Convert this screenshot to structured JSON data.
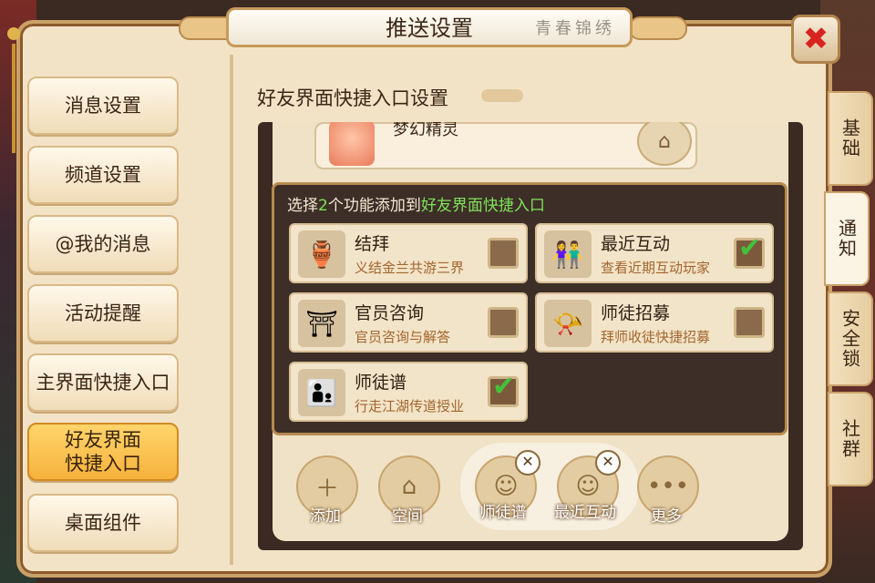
{
  "window": {
    "title": "推送设置",
    "title_deco": "青春锦绣",
    "close_glyph": "✖"
  },
  "nav": {
    "items": [
      {
        "label": "消息设置"
      },
      {
        "label": "频道设置"
      },
      {
        "label": "@我的消息"
      },
      {
        "label": "活动提醒"
      },
      {
        "label": "主界面快捷入口"
      },
      {
        "label": "好友界面快捷入口",
        "active": true
      },
      {
        "label": "桌面组件"
      }
    ]
  },
  "side_tabs": [
    {
      "label": "基础"
    },
    {
      "label": "通知",
      "active": true
    },
    {
      "label": "安全锁"
    },
    {
      "label": "社群"
    }
  ],
  "section": {
    "title": "好友界面快捷入口设置"
  },
  "preview": {
    "friend_name": "梦幻精灵",
    "home_icon": "home-icon",
    "bottom": {
      "add_label": "添加",
      "space_label": "空间",
      "selected": [
        {
          "label": "师徒谱"
        },
        {
          "label": "最近互动"
        }
      ],
      "more_label": "更多",
      "remove_glyph": "✕"
    }
  },
  "modal": {
    "prompt_prefix": "选择",
    "prompt_count": "2",
    "prompt_mid": "个功能添加到",
    "prompt_target": "好友界面快捷入口",
    "options": [
      {
        "name": "结拜",
        "desc": "义结金兰共游三界",
        "checked": false,
        "icon": "wine-jar-icon"
      },
      {
        "name": "最近互动",
        "desc": "查看近期互动玩家",
        "checked": true,
        "icon": "couple-icon"
      },
      {
        "name": "官员咨询",
        "desc": "官员咨询与解答",
        "checked": false,
        "icon": "pavilion-icon"
      },
      {
        "name": "师徒招募",
        "desc": "拜师收徒快捷招募",
        "checked": false,
        "icon": "horn-icon"
      },
      {
        "name": "师徒谱",
        "desc": "行走江湖传道授业",
        "checked": true,
        "icon": "master-disciple-icon"
      }
    ]
  },
  "colors": {
    "accent_green": "#7fe35a",
    "nav_active": "#f6b23c",
    "close_red": "#d8231f"
  }
}
